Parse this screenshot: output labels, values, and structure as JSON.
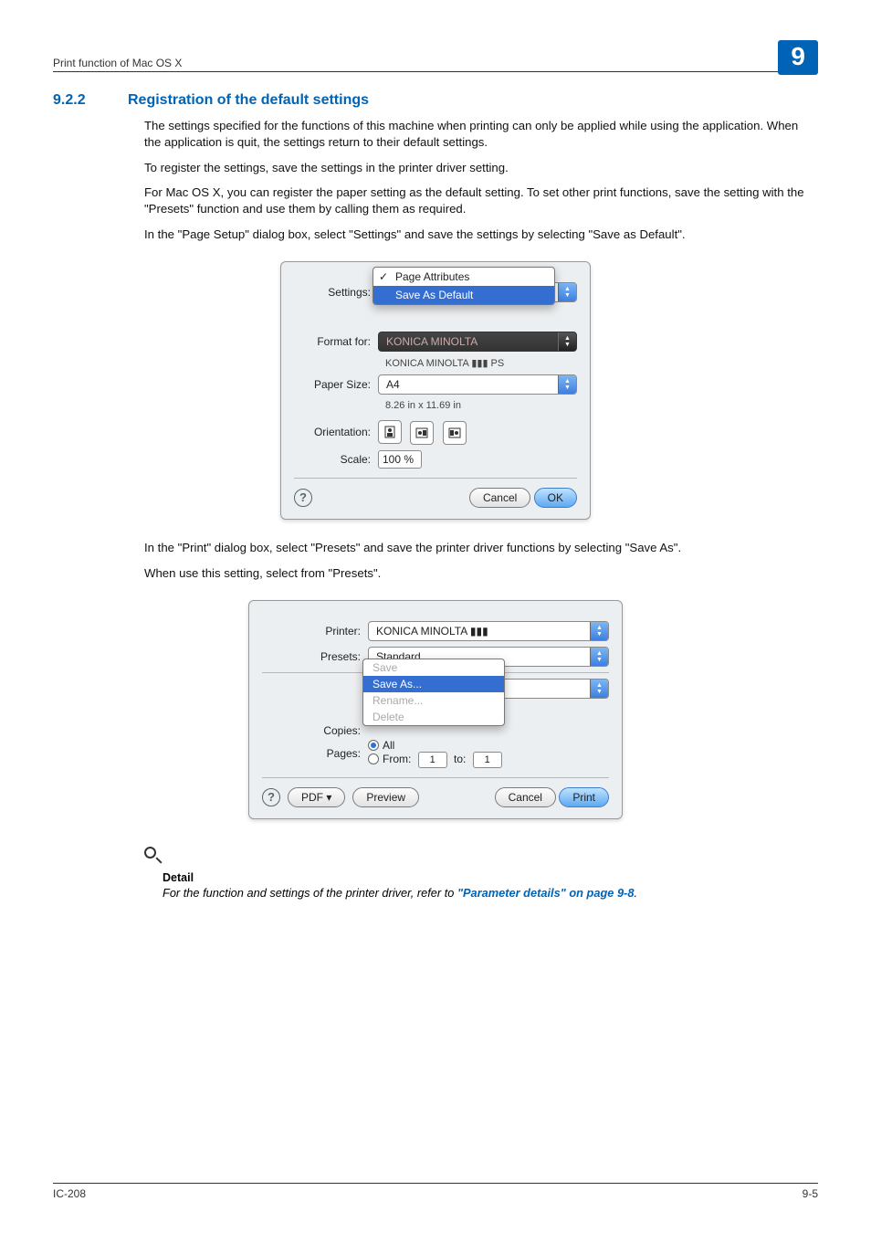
{
  "header": {
    "left": "Print function of Mac OS X",
    "chapter": "9"
  },
  "section": {
    "number": "9.2.2",
    "title": "Registration of the default settings"
  },
  "paragraphs": {
    "p1": "The settings specified for the functions of this machine when printing can only be applied while using the application. When the application is quit, the settings return to their default settings.",
    "p2": "To register the settings, save the settings in the printer driver setting.",
    "p3": "For Mac OS X, you can register the paper setting as the default setting. To set other print functions, save the setting with the \"Presets\" function and use them by calling them as required.",
    "p4": "In the \"Page Setup\" dialog box, select \"Settings\" and save the settings by selecting \"Save as Default\".",
    "p5": "In the \"Print\" dialog box, select \"Presets\" and save the printer driver functions by selecting \"Save As\".",
    "p6": "When use this setting, select from \"Presets\"."
  },
  "dialog1": {
    "labels": {
      "settings": "Settings:",
      "formatfor": "Format for:",
      "papersize": "Paper Size:",
      "orientation": "Orientation:",
      "scale": "Scale:"
    },
    "settings_opt_checked": "Page Attributes",
    "settings_opt_hi": "Save As Default",
    "format_sub": "KONICA MINOLTA ▮▮▮ PS",
    "papersize_val": "A4",
    "papersize_sub": "8.26 in x 11.69 in",
    "scale_val": "100 %",
    "cancel": "Cancel",
    "ok": "OK"
  },
  "dialog2": {
    "labels": {
      "printer": "Printer:",
      "presets": "Presets:",
      "copies": "Copies:",
      "pages": "Pages:"
    },
    "printer_val": "KONICA MINOLTA ▮▮▮",
    "presets_val": "Standard",
    "popup": {
      "save": "Save",
      "saveas": "Save As...",
      "rename": "Rename...",
      "delete": "Delete"
    },
    "pages_all": "All",
    "from_lbl": "From:",
    "from_val": "1",
    "to_lbl": "to:",
    "to_val": "1",
    "pdf": "PDF ▾",
    "preview": "Preview",
    "cancel": "Cancel",
    "print": "Print"
  },
  "detail": {
    "label": "Detail",
    "text_pre": "For the function and settings of the printer driver, refer to ",
    "link": "\"Parameter details\" on page 9-8",
    "text_post": "."
  },
  "footer": {
    "left": "IC-208",
    "right": "9-5"
  }
}
